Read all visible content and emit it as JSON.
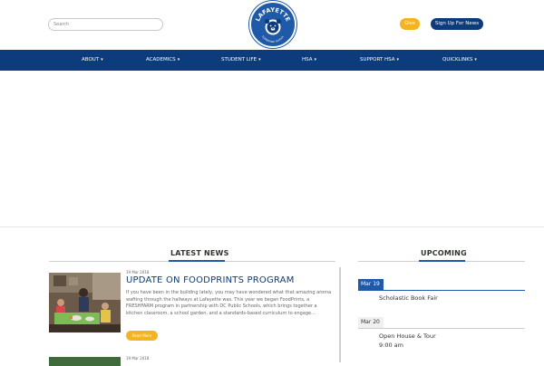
{
  "header": {
    "search_placeholder": "Search",
    "give_label": "Give",
    "signup_label": "Sign Up For News",
    "logo_text_top": "LAFAYETTE",
    "logo_text_bottom": "ELEMENTARY SCHOOL"
  },
  "nav": {
    "items": [
      {
        "label": "ABOUT"
      },
      {
        "label": "ACADEMICS"
      },
      {
        "label": "STUDENT LIFE"
      },
      {
        "label": "HSA"
      },
      {
        "label": "SUPPORT HSA"
      },
      {
        "label": "QUICKLINKS"
      }
    ],
    "caret": "▾"
  },
  "news": {
    "heading": "LATEST NEWS",
    "items": [
      {
        "date": "19 Mar 2018",
        "title": "UPDATE ON FOODPRINTS PROGRAM",
        "body": "If you have been in the building lately, you may have wondered what that amazing aroma wafting through the hallways at Lafayette was. This year we began FoodPrints, a FRESHFARM program in partnership with DC Public Schools, which brings together a kitchen classroom, a school garden, and a standards-based curriculum to engage…",
        "read_more": "Read More"
      },
      {
        "date": "19 Mar 2018"
      }
    ]
  },
  "upcoming": {
    "heading": "UPCOMING",
    "events": [
      {
        "date": "Mar 19",
        "name": "Scholastic Book Fair",
        "time": ""
      },
      {
        "date": "Mar 20",
        "name": "Open House & Tour",
        "time": "9:00 am"
      }
    ]
  },
  "colors": {
    "navy": "#0c3c7c",
    "blue": "#1f5aa8",
    "gold": "#f4b321"
  }
}
